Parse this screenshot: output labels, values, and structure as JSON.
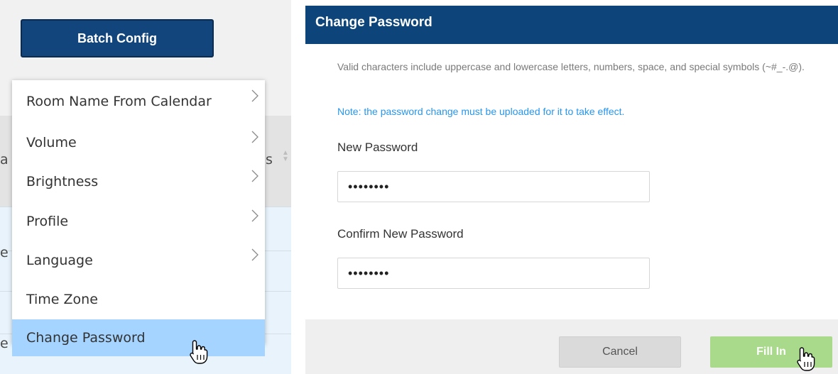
{
  "batch_config": {
    "label": "Batch Config"
  },
  "background_table": {
    "header_fragments": {
      "left": "a",
      "right": "s"
    },
    "row_fragments": [
      "e",
      "e"
    ]
  },
  "menu": {
    "items": [
      {
        "label": "Room Name From Calendar",
        "has_submenu": true
      },
      {
        "label": "Volume",
        "has_submenu": true
      },
      {
        "label": "Brightness",
        "has_submenu": true
      },
      {
        "label": "Profile",
        "has_submenu": true
      },
      {
        "label": "Language",
        "has_submenu": true
      },
      {
        "label": "Time Zone",
        "has_submenu": false
      },
      {
        "label": "Change Password",
        "has_submenu": false,
        "selected": true
      }
    ]
  },
  "dialog": {
    "title": "Change Password",
    "valid_chars": "Valid characters include uppercase and lowercase letters, numbers, space, and special symbols (~#_-.@).",
    "note": "Note: the password change must be uploaded for it to take effect.",
    "new_password": {
      "label": "New Password",
      "value": "••••••••"
    },
    "confirm_password": {
      "label": "Confirm New Password",
      "value": "••••••••"
    },
    "cancel_label": "Cancel",
    "fill_in_label": "Fill In"
  },
  "colors": {
    "header_blue": "#0d457b",
    "selected_item": "#a4d4ff",
    "note_blue": "#2796ee",
    "fill_in_green": "#a9d98a"
  },
  "icons": [
    "chevron-right-icon",
    "sort-arrows-icon",
    "hand-pointer-icon"
  ]
}
